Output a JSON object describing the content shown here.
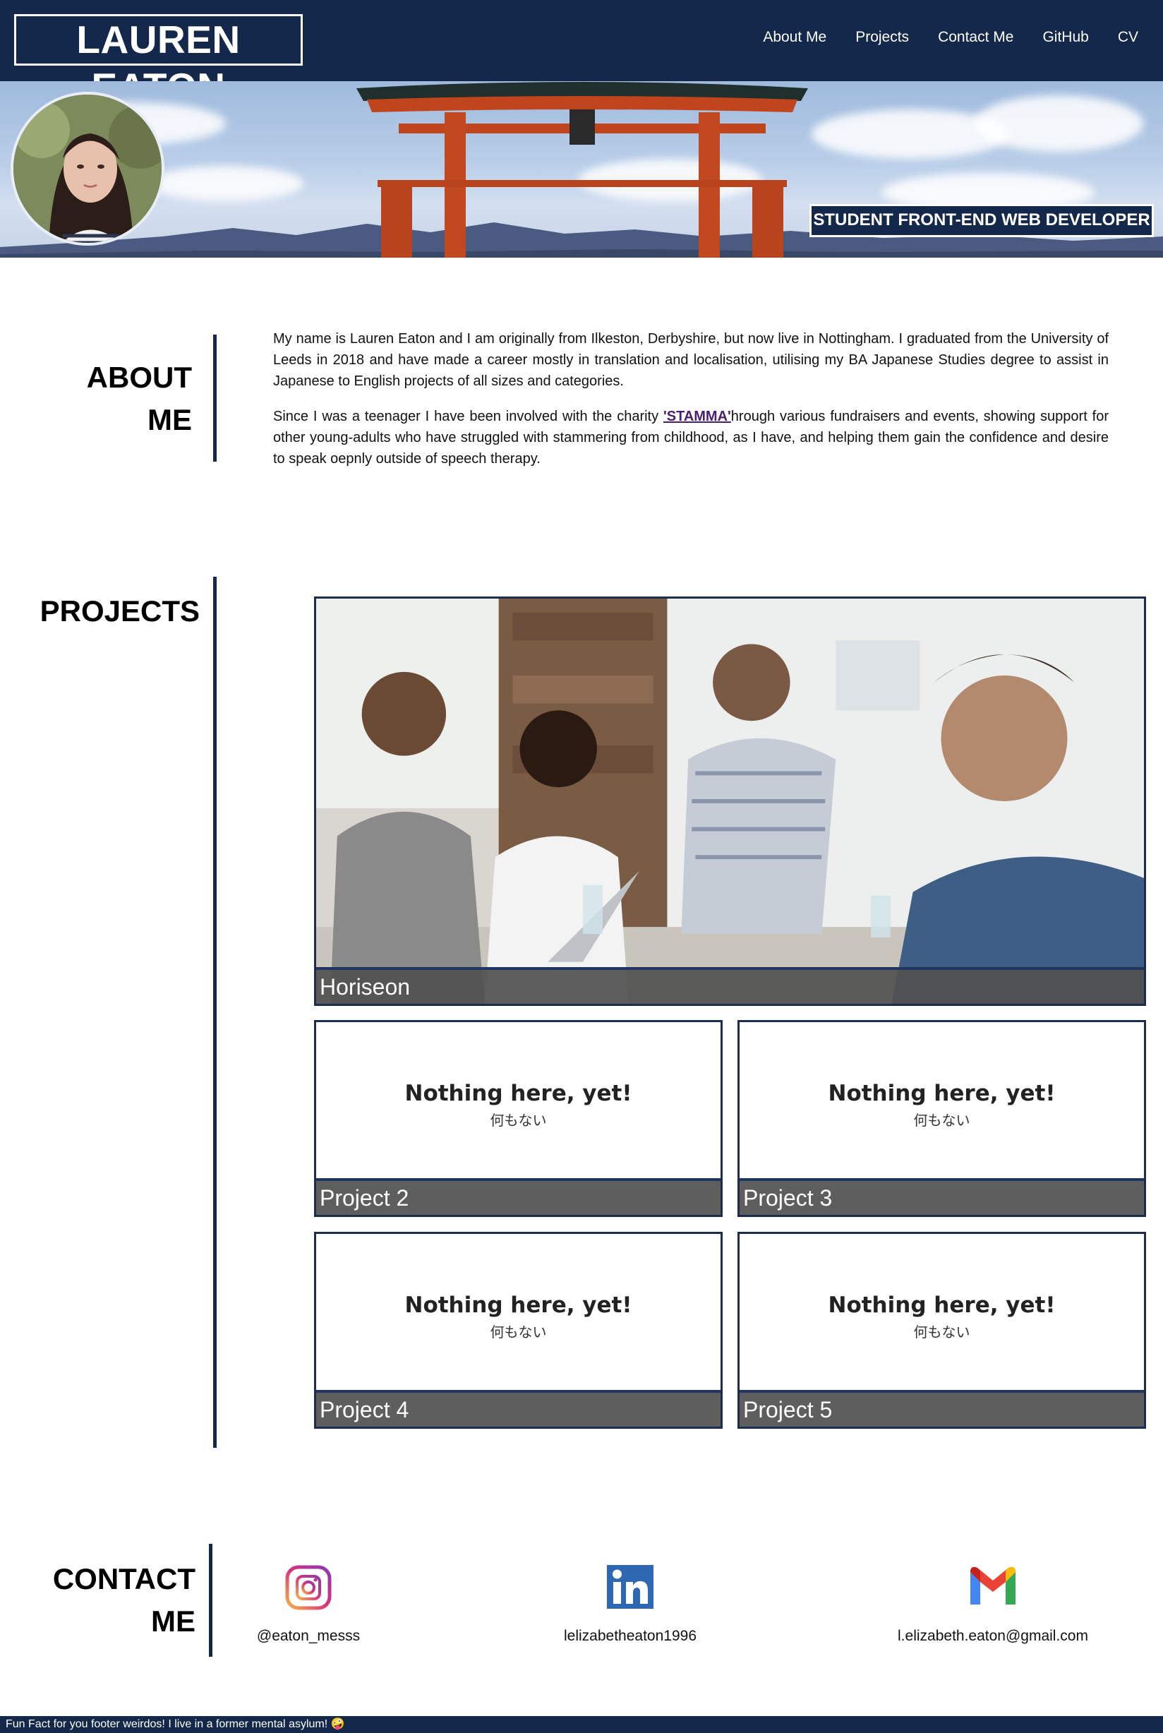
{
  "header": {
    "logo": "LAUREN EATON",
    "nav": [
      "About Me",
      "Projects",
      "Contact Me",
      "GitHub",
      "CV"
    ]
  },
  "hero": {
    "tagline": "STUDENT FRONT-END WEB DEVELOPER"
  },
  "about": {
    "title_line1": "ABOUT",
    "title_line2": "ME",
    "p1": "My name is Lauren Eaton and I am originally from Ilkeston, Derbyshire, but now live in Nottingham. I graduated from the University of Leeds in 2018 and have made a career mostly in translation and localisation, utilising my BA Japanese Studies degree to assist in Japanese to English projects of all sizes and categories.",
    "p2_before": "Since I was a teenager I have been involved with the charity ",
    "p2_link": "'STAMMA'",
    "p2_after": "hrough various fundraisers and events, showing support for other young-adults who have struggled with stammering from childhood, as I have, and helping them gain the confidence and desire to speak oepnly outside of speech therapy."
  },
  "projects": {
    "title": "PROJECTS",
    "featured": "Horiseon",
    "placeholder_title": "Nothing here, yet!",
    "placeholder_sub": "何もない",
    "items": [
      "Project 2",
      "Project 3",
      "Project 4",
      "Project 5"
    ]
  },
  "contact": {
    "title_line1": "CONTACT",
    "title_line2": "ME",
    "instagram": "@eaton_messs",
    "linkedin": "lelizabetheaton1996",
    "email": "l.elizabeth.eaton@gmail.com"
  },
  "footer": {
    "text": "Fun Fact for you footer weirdos! I live in a former mental asylum! 🤪"
  },
  "colors": {
    "navy": "#13284a",
    "link": "#4b1e6e",
    "caption": "#505050"
  }
}
